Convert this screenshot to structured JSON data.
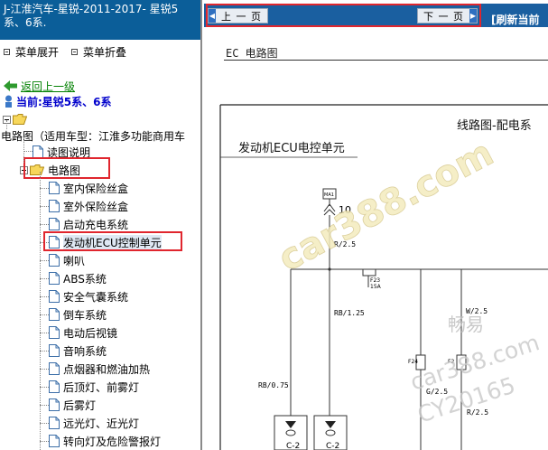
{
  "left_panel": {
    "title": "J-江淮汽车-星锐-2011-2017- 星锐5系、6系.",
    "menu_expand": "菜单展开",
    "menu_collapse": "菜单折叠",
    "back_link": "返回上一级",
    "current": "当前:星锐5系、6系",
    "tree": {
      "root_label": "电路图（适用车型：江淮多功能商用车",
      "intro": "读图说明",
      "folder": "电路图",
      "items": [
        "室内保险丝盒",
        "室外保险丝盒",
        "启动充电系统",
        "发动机ECU控制单元",
        "喇叭",
        "ABS系统",
        "安全气囊系统",
        "倒车系统",
        "电动后视镜",
        "音响系统",
        "点烟器和燃油加热",
        "后顶灯、前雾灯",
        "后雾灯",
        "远光灯、近光灯",
        "转向灯及危险警报灯"
      ]
    }
  },
  "navbar": {
    "prev": "上 一 页",
    "next": "下 一 页",
    "refresh": "[刷新当前"
  },
  "document": {
    "header": "EC 电路图",
    "title_right": "线路图-配电系",
    "subtitle": "发动机ECU电控单元",
    "junction": "10",
    "fuse_label": "F23\n15A",
    "wires": [
      "R/2.5",
      "RB/1.25",
      "W/2.5",
      "RB/0.75",
      "G/2.5",
      "R/2.5"
    ],
    "fuse_left": "F24",
    "fuse_right": "F2",
    "watermarks": [
      "car388.com",
      "畅易",
      "car388.com",
      "CY20165"
    ]
  },
  "colors": {
    "title_bar": "#0b5e99",
    "navbar": "#1a5fa0",
    "highlight": "#e0262e",
    "back_link": "#008000",
    "current": "#0000cc"
  }
}
